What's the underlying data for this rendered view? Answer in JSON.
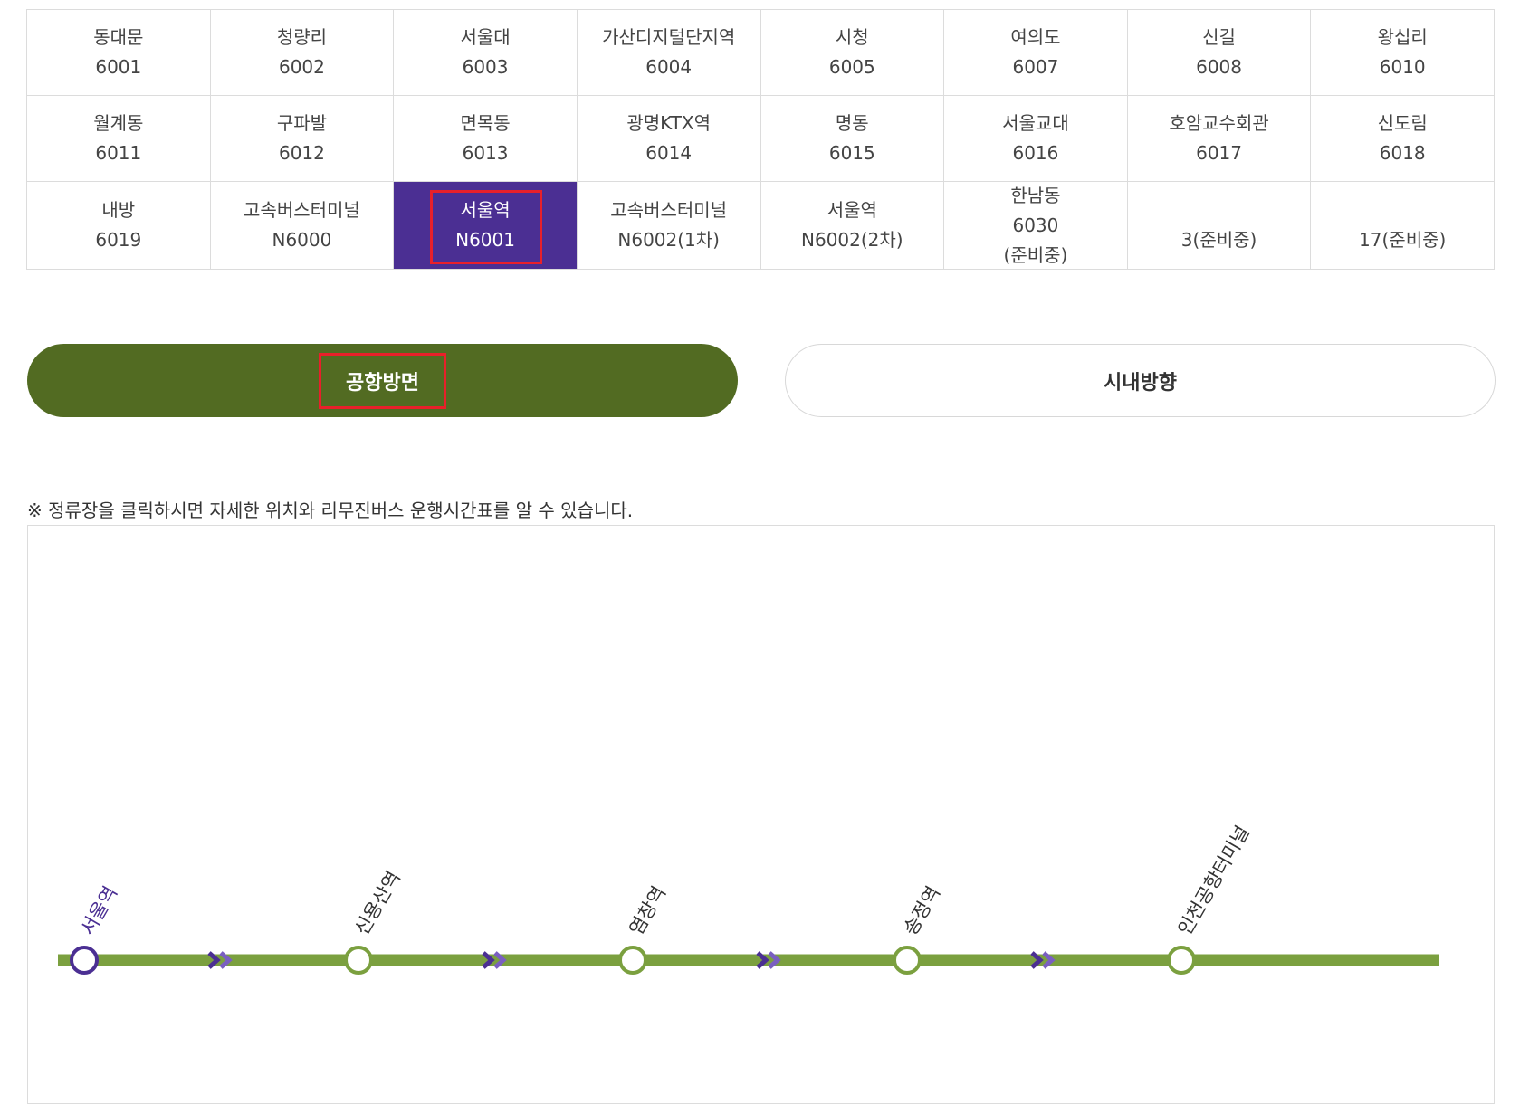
{
  "colors": {
    "active_bg": "#4b2f93",
    "airport_btn_bg": "#526b22",
    "highlight_border": "#e8202a",
    "route_line": "#7ba03f",
    "current_stop": "#4b2f93",
    "arrow_dark": "#4b2f93",
    "arrow_light": "#7a5fc1"
  },
  "routes": [
    {
      "name": "동대문",
      "code": "6001"
    },
    {
      "name": "청량리",
      "code": "6002"
    },
    {
      "name": "서울대",
      "code": "6003"
    },
    {
      "name": "가산디지털단지역",
      "code": "6004"
    },
    {
      "name": "시청",
      "code": "6005"
    },
    {
      "name": "여의도",
      "code": "6007"
    },
    {
      "name": "신길",
      "code": "6008"
    },
    {
      "name": "왕십리",
      "code": "6010"
    },
    {
      "name": "월계동",
      "code": "6011"
    },
    {
      "name": "구파발",
      "code": "6012"
    },
    {
      "name": "면목동",
      "code": "6013"
    },
    {
      "name": "광명KTX역",
      "code": "6014"
    },
    {
      "name": "명동",
      "code": "6015"
    },
    {
      "name": "서울교대",
      "code": "6016"
    },
    {
      "name": "호암교수회관",
      "code": "6017"
    },
    {
      "name": "신도림",
      "code": "6018"
    },
    {
      "name": "내방",
      "code": "6019"
    },
    {
      "name": "고속버스터미널",
      "code": "N6000"
    },
    {
      "name": "서울역",
      "code": "N6001",
      "active": true
    },
    {
      "name": "고속버스터미널",
      "code": "N6002(1차)"
    },
    {
      "name": "서울역",
      "code": "N6002(2차)"
    },
    {
      "name": "한남동",
      "code": "6030",
      "extra": "(준비중)"
    },
    {
      "name": "",
      "code": "3(준비중)"
    },
    {
      "name": "",
      "code": "17(준비중)"
    }
  ],
  "direction": {
    "airport_label": "공항방면",
    "city_label": "시내방향",
    "selected": "airport"
  },
  "notice": "※ 정류장을 클릭하시면 자세한 위치와 리무진버스 운행시간표를 알 수 있습니다.",
  "stops": [
    {
      "name": "서울역",
      "current": true
    },
    {
      "name": "신용산역",
      "current": false
    },
    {
      "name": "염창역",
      "current": false
    },
    {
      "name": "송정역",
      "current": false
    },
    {
      "name": "인천공항터미널",
      "current": false
    }
  ]
}
